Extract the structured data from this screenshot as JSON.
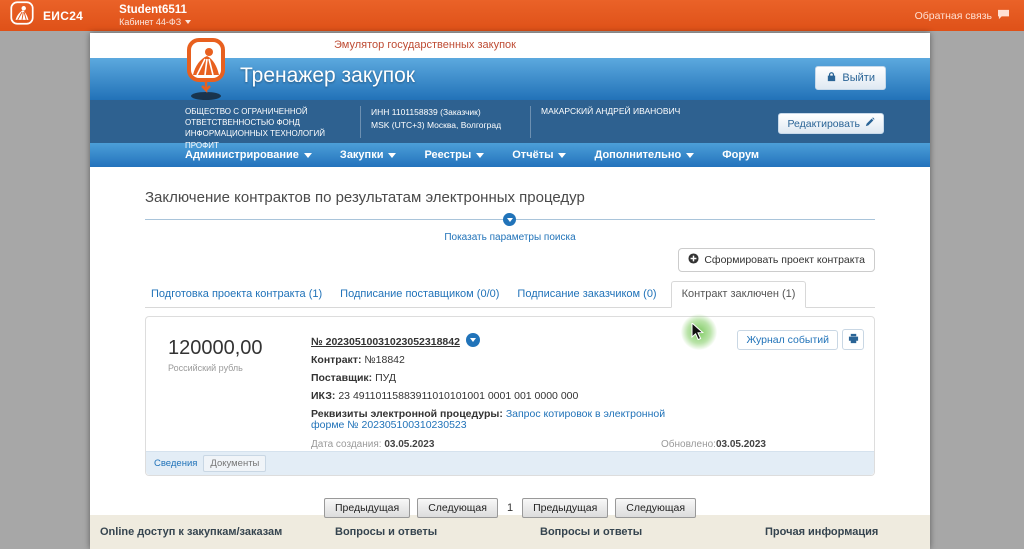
{
  "colors": {
    "topbar_orange": "#E4571C",
    "header_blue_top": "#5CA9DE",
    "header_blue_bottom": "#2272B8",
    "org_band_blue": "#2E6190",
    "link_blue": "#2173B9",
    "footer_beige": "#EFEBDF"
  },
  "topbar": {
    "brand": "ЕИС24",
    "user": "Student6511",
    "cabinet": "Кабинет 44-ФЗ",
    "feedback": "Обратная связь"
  },
  "header": {
    "emulator_label": "Эмулятор государственных закупок",
    "app_title": "Тренажер закупок",
    "logout": "Выйти",
    "org_name": "ОБЩЕСТВО С ОГРАНИЧЕННОЙ ОТВЕТСТВЕННОСТЬЮ ФОНД ИНФОРМАЦИОННЫХ ТЕХНОЛОГИЙ ПРОФИТ",
    "inn_line": "ИНН 1101158839 (Заказчик)",
    "timezone_line": "MSK (UTC+3) Москва, Волгоград",
    "person": "МАКАРСКИЙ АНДРЕЙ ИВАНОВИЧ",
    "edit": "Редактировать"
  },
  "nav": {
    "items": [
      {
        "label": "Администрирование"
      },
      {
        "label": "Закупки"
      },
      {
        "label": "Реестры"
      },
      {
        "label": "Отчёты"
      },
      {
        "label": "Дополнительно"
      },
      {
        "label": "Форум"
      }
    ]
  },
  "main": {
    "page_title": "Заключение контрактов по результатам электронных процедур",
    "show_search_params": "Показать параметры поиска",
    "create_button": "Сформировать проект контракта",
    "tabs": [
      {
        "label": "Подготовка проекта контракта (1)"
      },
      {
        "label": "Подписание поставщиком (0/0)"
      },
      {
        "label": "Подписание заказчиком (0)"
      },
      {
        "label": "Контракт заключен (1)",
        "active": true
      }
    ]
  },
  "contract": {
    "amount": "120000,00",
    "currency": "Российский рубль",
    "number": "№ 20230510031023052318842",
    "contract_label": "Контракт:",
    "contract_value": "№18842",
    "supplier_label": "Поставщик:",
    "supplier_value": "ПУД",
    "ikz_label": "ИКЗ:",
    "ikz_value": "23 49110115883911010101001 0001 001 0000 000",
    "requisites_label": "Реквизиты электронной процедуры:",
    "requisites_link": "Запрос котировок в электронной форме № 202305100310230523",
    "created_label": "Дата создания:",
    "created_value": "03.05.2023",
    "updated_label": "Обновлено:",
    "updated_value": "03.05.2023",
    "journal_button": "Журнал событий",
    "footer_tabs": [
      {
        "label": "Сведения"
      },
      {
        "label": "Документы"
      }
    ]
  },
  "pagination": {
    "prev": "Предыдущая",
    "next": "Следующая",
    "page": "1"
  },
  "footer": {
    "columns": [
      {
        "title": "Online доступ к закупкам/заказам"
      },
      {
        "title": "Вопросы и ответы"
      },
      {
        "title": "Вопросы и ответы"
      },
      {
        "title": "Прочая информация"
      }
    ]
  }
}
